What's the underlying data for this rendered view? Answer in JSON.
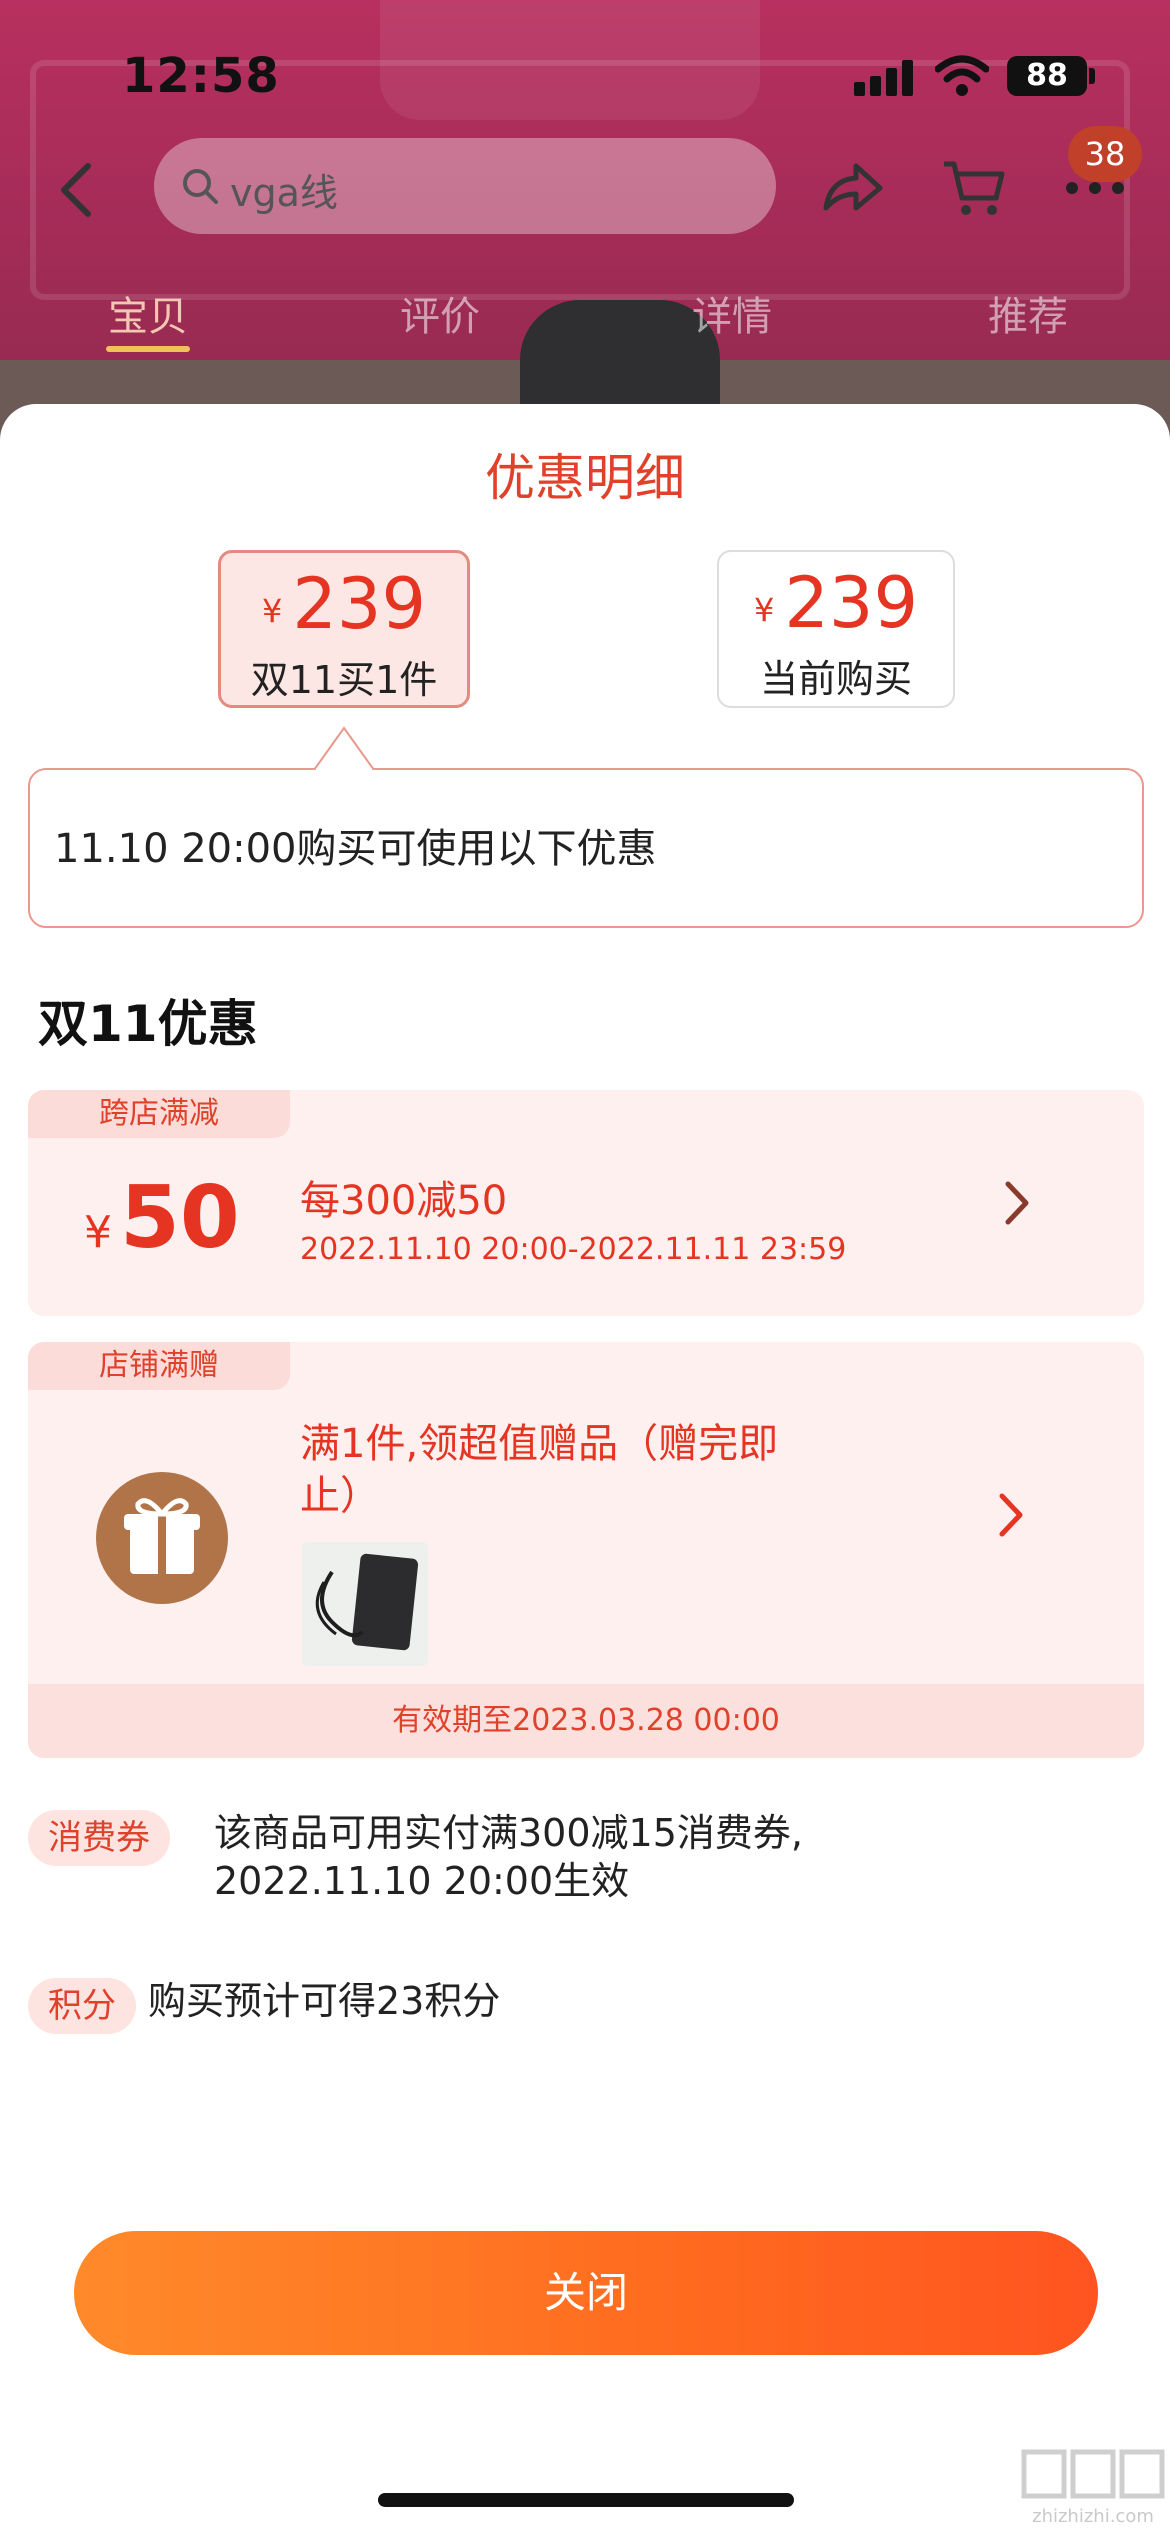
{
  "status_bar": {
    "time": "12:58",
    "battery": "88"
  },
  "header": {
    "search_text": "vga线",
    "cart_badge": "38",
    "tabs": [
      {
        "label": "宝贝",
        "active": true
      },
      {
        "label": "评价",
        "active": false
      },
      {
        "label": "详情",
        "active": false
      },
      {
        "label": "推荐",
        "active": false
      }
    ]
  },
  "sheet": {
    "title": "优惠明细",
    "prices": [
      {
        "currency": "¥",
        "amount": "239",
        "label": "双11买1件",
        "selected": true
      },
      {
        "currency": "¥",
        "amount": "239",
        "label": "当前购买",
        "selected": false
      }
    ],
    "info_text": "11.10 20:00购买可使用以下优惠",
    "section_title": "双11优惠",
    "cross_store": {
      "tag": "跨店满减",
      "currency": "¥",
      "amount": "50",
      "rule": "每300减50",
      "period": "2022.11.10 20:00-2022.11.11 23:59"
    },
    "store_gift": {
      "tag": "店铺满赠",
      "title": "满1件,领超值赠品（赠完即止）",
      "validity": "有效期至2023.03.28 00:00"
    },
    "coupon": {
      "badge": "消费券",
      "line1": "该商品可用实付满300减15消费券,",
      "line2": "2022.11.10 20:00生效"
    },
    "points": {
      "badge": "积分",
      "text": "购买预计可得23积分"
    },
    "close_label": "关闭"
  },
  "watermark": {
    "text": "zhizhizhi.com"
  },
  "colors": {
    "accent": "#e53422",
    "button": "#ff6a1f",
    "card_bg": "#fdf0ef"
  }
}
